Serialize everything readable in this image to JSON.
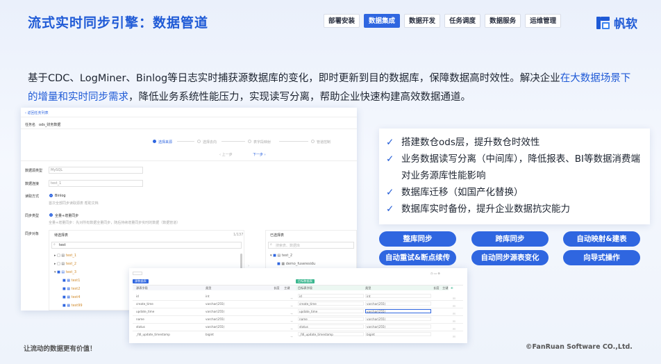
{
  "slide": {
    "title": "流式实时同步引擎：数据管道",
    "nav": [
      "部署安装",
      "数据集成",
      "数据开发",
      "任务调度",
      "数据服务",
      "运维管理"
    ],
    "nav_active": 1,
    "logo_text": "帆软",
    "desc_part1": "基于CDC、LogMiner、Binlog等日志实时捕获源数据库的变化，即时更新到目的数据库，保障数据高时效性。解决企业",
    "desc_hl": "在大数据场景下的增量和实时同步需求",
    "desc_part2": "，降低业务系统性能压力，实现读写分离，帮助企业快速构建高效数据通道。",
    "features": [
      "搭建数仓ods层，提升数仓时效性",
      "业务数据读写分离（中间库），降低报表、BI等数据消费端对业务源库性能影响",
      "数据库迁移（如国产化替换）",
      "数据库实时备份，提升企业数据抗灾能力"
    ],
    "pills": [
      "整库同步",
      "跨库同步",
      "自动映射&建表",
      "自动重试&断点续传",
      "自动同步源表变化",
      "向导式操作"
    ],
    "footer_left": "让流动的数据更有价值！",
    "footer_right": "©FanRuan Software CO.,Ltd.",
    "accent": "#2f66e0"
  },
  "shot1": {
    "back": "返回任务列表",
    "task_label": "任务名",
    "task_name": "ods_财务数据",
    "steps": [
      "选择来源",
      "选择去向",
      "表字段映射",
      "管道控制"
    ],
    "prev": "上一步",
    "next": "下一步",
    "db_type_label": "数据源类型",
    "db_type": "MySQL",
    "db_conn_label": "数据连接",
    "db_conn": "test_1",
    "read_label": "读取方式",
    "read_mode": "Binlog",
    "read_hint": "首次全部同步读取源表  帮助文档",
    "sync_label": "同步类型",
    "sync_mode": "全量+增量同步",
    "sync_hint": "全量+增量同步：先对所有数据全量同步，随后持续增量同步实时的数据（数据管道）",
    "src_label": "同步对象",
    "left_panel": "待选择表",
    "count": "1/137",
    "search": "test",
    "tree_left": [
      "test_1",
      "test_2",
      "test_3",
      "test1",
      "test2",
      "test4",
      "test99"
    ],
    "right_panel": "已选择表",
    "right_search": "搜索表、数据库",
    "tree_right": [
      "test_2",
      "demo_fuseresidu"
    ]
  },
  "shot2": {
    "tabs": [
      "源数据表",
      "目标数据表"
    ],
    "hdr_left": [
      "源表字段",
      "类型",
      "长度",
      "主键"
    ],
    "hdr_right": [
      "目标表字段",
      "类型",
      "长度",
      "主键"
    ],
    "rows": [
      [
        "id",
        "int",
        "id",
        "int"
      ],
      [
        "create_time",
        "varchar(255)",
        "create_time",
        "varchar(255)"
      ],
      [
        "update_time",
        "varchar(255)",
        "update_time",
        "varchar(255)"
      ],
      [
        "name",
        "varchar(255)",
        "name",
        "varchar(255)"
      ],
      [
        "status",
        "varchar(255)",
        "status",
        "varchar(255)"
      ],
      [
        "_fdl_update_timestamp",
        "bigint",
        "_fdl_update_timestamp",
        "bigint"
      ]
    ]
  }
}
